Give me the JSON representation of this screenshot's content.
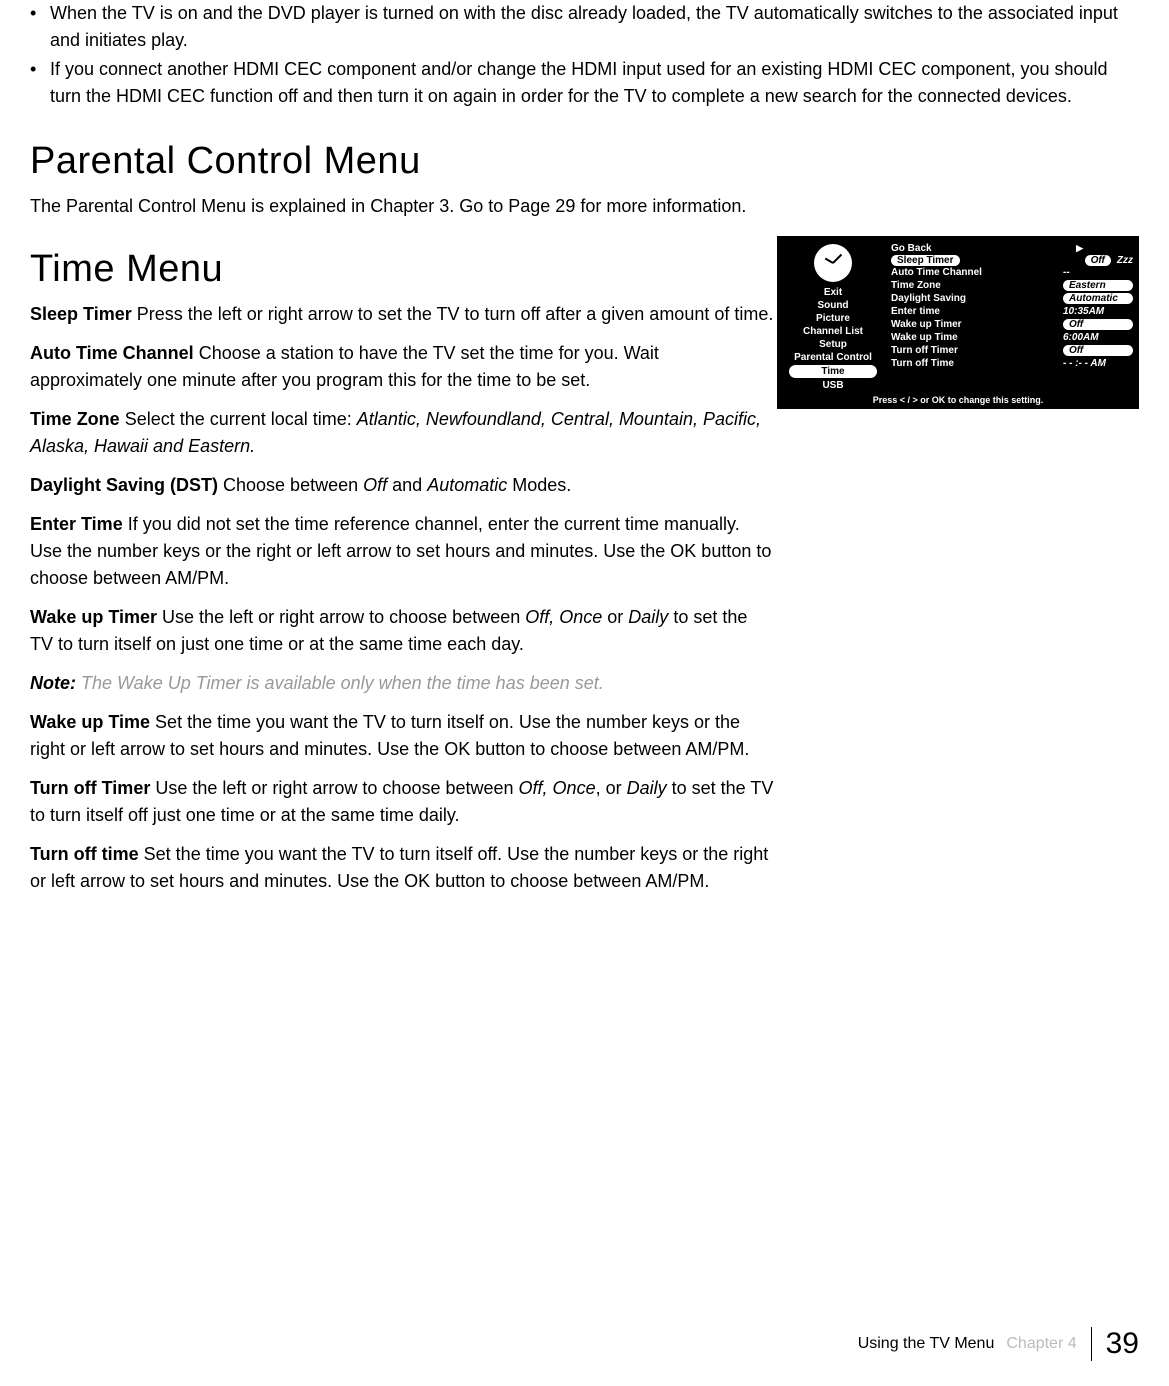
{
  "bullets": [
    "When the TV is on and the DVD player is turned on with the disc already loaded, the TV automatically switches to the associated input and initiates play.",
    "If you connect another HDMI CEC component and/or change the HDMI input used for an existing HDMI CEC component, you should turn the HDMI CEC function off and then turn it on again in order for the TV to complete a new search for the connected devices."
  ],
  "headings": {
    "parental": "Parental Control Menu",
    "time": "Time Menu"
  },
  "parental_text": "The Parental Control Menu is explained in Chapter 3.  Go to Page 29 for more information.",
  "time_items": {
    "sleep_timer_term": "Sleep Timer",
    "sleep_timer_pre": "    Press the left or right arrow to set the TV to turn off after a given amount of time.",
    "auto_time_term": "Auto Time Channel",
    "auto_time_pre": "    Choose a station to have the TV set the time for you.  Wait approximately one minute after you program this for the time to be set.",
    "time_zone_term": "Time Zone",
    "time_zone_pre": "    Select the current local time: ",
    "time_zone_values": "Atlantic, Newfoundland, Central, Mountain, Pacific, Alaska, Hawaii and Eastern.",
    "dst_term": "Daylight Saving (DST)",
    "dst_pre": "    Choose between ",
    "dst_v1": "Off",
    "dst_mid": " and ",
    "dst_v2": "Automatic",
    "dst_post": " Modes.",
    "enter_time_term": "Enter Time",
    "enter_time_pre": "    If you did not set the time reference channel, enter the current time manually.  Use the number keys or the right or left arrow to set hours and minutes. Use the OK button to choose between AM/PM.",
    "wake_timer_term": "Wake up Timer",
    "wake_timer_pre": "    Use the left or right arrow to choose between ",
    "wake_timer_v1": "Off, Once",
    "wake_timer_mid": " or ",
    "wake_timer_v2": "Daily",
    "wake_timer_post": " to set the TV to turn itself on just one time or at the same time each day.",
    "note_label": "Note:",
    "note_text": " The Wake Up Timer is available only when the time has been set.",
    "wake_time_term": "Wake up Time",
    "wake_time_pre": "    Set the time you want the TV to turn itself on.  Use the number keys or the right or left arrow to set hours and minutes. Use the OK button to choose between AM/PM.",
    "turnoff_timer_term": "Turn off Timer",
    "turnoff_timer_pre": "    Use the left or right arrow to choose between ",
    "turnoff_timer_v1": "Off, Once",
    "turnoff_timer_mid": ", or ",
    "turnoff_timer_v2": "Daily",
    "turnoff_timer_post": " to set the TV to turn itself off just one time or at the same time daily.",
    "turnoff_time_term": "Turn off time",
    "turnoff_time_pre": "    Set the time you want the TV to turn itself off. Use the number keys or the right or left arrow to set hours and minutes. Use the OK button to choose between AM/PM."
  },
  "menu": {
    "side": [
      "Exit",
      "Sound",
      "Picture",
      "Channel List",
      "Setup",
      "Parental Control",
      "Time",
      "USB"
    ],
    "rows": {
      "go_back": "Go Back",
      "sleep_timer": "Sleep Timer",
      "sleep_val": "Off",
      "sleep_zzz": "Zzz",
      "auto_time": "Auto Time Channel",
      "auto_time_val": "--",
      "time_zone": "Time Zone",
      "time_zone_val": "Eastern",
      "dst": "Daylight Saving",
      "dst_val": "Automatic",
      "enter_time": "Enter time",
      "enter_time_val": "10:35AM",
      "wake_timer": "Wake up Timer",
      "wake_timer_val": "Off",
      "wake_time": "Wake up Time",
      "wake_time_val": "6:00AM",
      "turnoff_timer": "Turn off Timer",
      "turnoff_timer_val": "Off",
      "turnoff_time": "Turn off Time",
      "turnoff_time_val": "- - :- - AM"
    },
    "footer": "Press < / >  or OK to change this setting."
  },
  "footer": {
    "title": "Using the TV Menu",
    "chapter": "Chapter 4",
    "page": "39"
  }
}
